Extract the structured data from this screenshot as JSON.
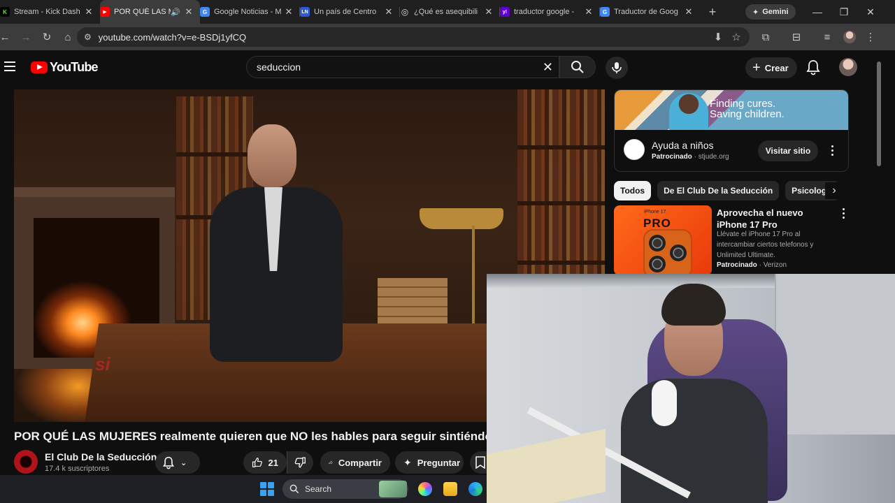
{
  "browser": {
    "tabs": [
      {
        "title": "Stream - Kick Dash",
        "favicon_color": "#53fc18",
        "favicon_glyph": "K"
      },
      {
        "title": "POR QUÉ LAS M",
        "favicon_color": "#ff0000",
        "favicon_glyph": "▶",
        "active": true
      },
      {
        "title": "Google Noticias - M",
        "favicon_color": "#4285f4",
        "favicon_glyph": "G"
      },
      {
        "title": "Un país de Centro",
        "favicon_color": "#2a5bd7",
        "favicon_glyph": "LN"
      },
      {
        "title": "¿Qué es asequibili",
        "favicon_color": "#8a8a8a",
        "favicon_glyph": "◎"
      },
      {
        "title": "traductor google -",
        "favicon_color": "#6001d2",
        "favicon_glyph": "y!"
      },
      {
        "title": "Traductor de Goog",
        "favicon_color": "#4285f4",
        "favicon_glyph": "G"
      }
    ],
    "gemini_label": "Gemini",
    "url": "youtube.com/watch?v=e-BSDj1yfCQ"
  },
  "youtube": {
    "logo_text": "YouTube",
    "search_value": "seduccion",
    "create_label": "Crear"
  },
  "video": {
    "caption_text": "si",
    "title": "POR QUÉ LAS MUJERES realmente quieren que NO les hables para seguir sintiéndose atraídas",
    "channel_name": "El Club De la Seducción",
    "subscribers": "17.4 k suscriptores",
    "likes": "21",
    "share_label": "Compartir",
    "ask_label": "Preguntar"
  },
  "ad": {
    "slogan_line1": "Finding cures.",
    "slogan_line2": "Saving children.",
    "title": "Ayuda a niños",
    "sponsored": "Patrocinado",
    "domain": "stjude.org",
    "visit_label": "Visitar sitio"
  },
  "chips": [
    "Todos",
    "De El Club De la Seducción",
    "Psicología"
  ],
  "recommendation": {
    "thumb_brand": "iPhone 17",
    "thumb_pro": "PRO",
    "title": "Aprovecha el nuevo iPhone 17 Pro",
    "description": "Llévate el iPhone 17 Pro al intercambiar ciertos telefonos y Unlimited Ultimate.",
    "sponsored": "Patrocinado",
    "advertiser": "Verizon"
  },
  "taskbar": {
    "search_label": "Search"
  }
}
